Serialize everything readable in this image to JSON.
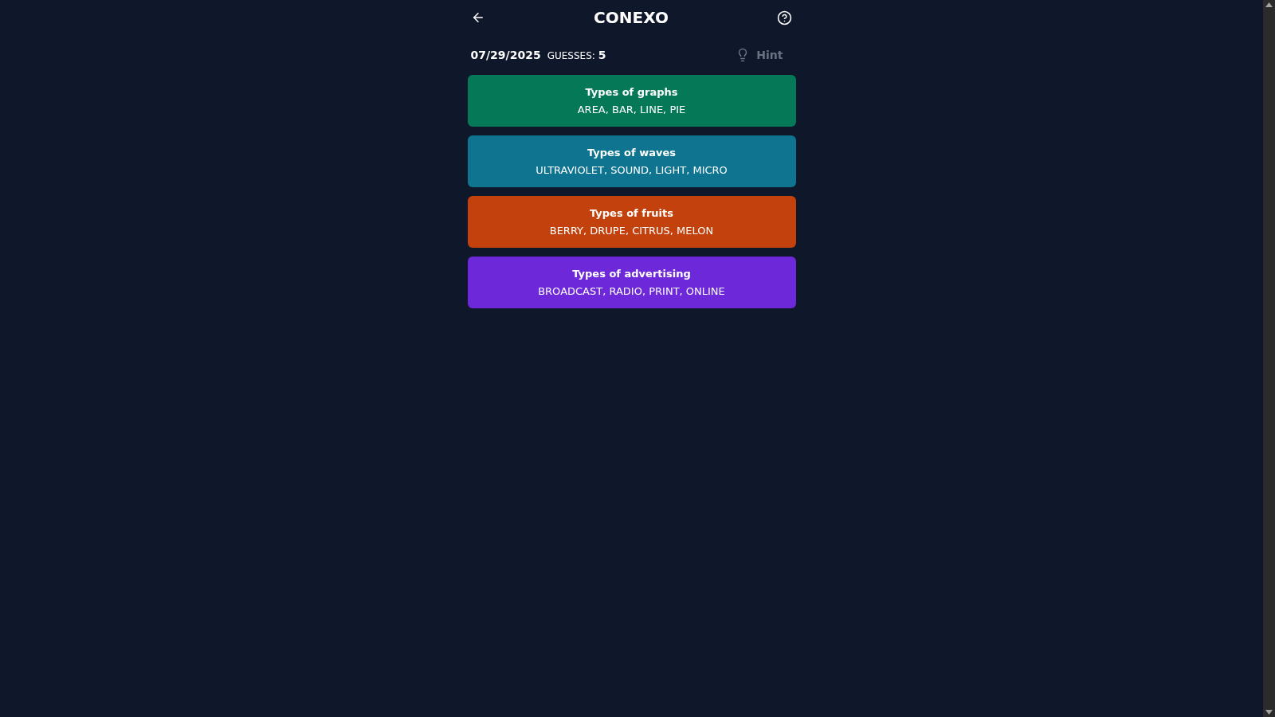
{
  "header": {
    "title": "CONEXO"
  },
  "status": {
    "date": "07/29/2025",
    "guesses_label": "GUESSES:",
    "guesses": "5"
  },
  "hint": {
    "label": "Hint",
    "disabled": true
  },
  "groups": [
    {
      "title": "Types of graphs",
      "words": "AREA, BAR, LINE, PIE",
      "color": "#047857"
    },
    {
      "title": "Types of waves",
      "words": "ULTRAVIOLET, SOUND, LIGHT, MICRO",
      "color": "#0e7490"
    },
    {
      "title": "Types of fruits",
      "words": "BERRY, DRUPE, CITRUS, MELON",
      "color": "#c2410c"
    },
    {
      "title": "Types of advertising",
      "words": "BROADCAST, RADIO, PRINT, ONLINE",
      "color": "#6d28d9"
    }
  ]
}
